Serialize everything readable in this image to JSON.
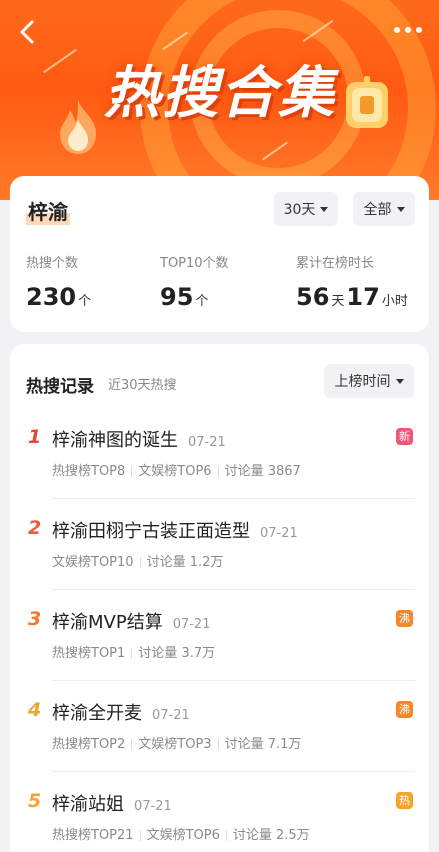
{
  "banner": {
    "title": "热搜合集"
  },
  "summary": {
    "name": "梓渝",
    "range_filter": "30天",
    "category_filter": "全部",
    "stats": [
      {
        "label": "热搜个数",
        "value": "230",
        "unit": "个"
      },
      {
        "label": "TOP10个数",
        "value": "95",
        "unit": "个"
      },
      {
        "label": "累计在榜时长",
        "days": "56",
        "days_unit": "天",
        "hours": "17",
        "hours_unit": "小时"
      }
    ]
  },
  "records": {
    "title": "热搜记录",
    "subtitle": "近30天热搜",
    "sort_label": "上榜时间",
    "items": [
      {
        "rank": "1",
        "title": "梓渝神图的诞生",
        "date": "07-21",
        "meta": [
          "热搜榜TOP8",
          "文娱榜TOP6",
          "讨论量 3867"
        ],
        "badge": "新",
        "badge_color": "#f0557a",
        "rank_color": "#e8443a"
      },
      {
        "rank": "2",
        "title": "梓渝田栩宁古装正面造型",
        "date": "07-21",
        "meta": [
          "文娱榜TOP10",
          "讨论量 1.2万"
        ],
        "badge": "",
        "badge_color": "",
        "rank_color": "#ee5a3d"
      },
      {
        "rank": "3",
        "title": "梓渝MVP结算",
        "date": "07-21",
        "meta": [
          "热搜榜TOP1",
          "讨论量 3.7万"
        ],
        "badge": "沸",
        "badge_color": "#f7862a",
        "rank_color": "#f27a2a"
      },
      {
        "rank": "4",
        "title": "梓渝全开麦",
        "date": "07-21",
        "meta": [
          "热搜榜TOP2",
          "文娱榜TOP3",
          "讨论量 7.1万"
        ],
        "badge": "沸",
        "badge_color": "#f7862a",
        "rank_color": "#f6a133"
      },
      {
        "rank": "5",
        "title": "梓渝站姐",
        "date": "07-21",
        "meta": [
          "热搜榜TOP21",
          "文娱榜TOP6",
          "讨论量 2.5万"
        ],
        "badge": "热",
        "badge_color": "#f6a32c",
        "rank_color": "#f6a133"
      }
    ]
  },
  "colors": {
    "accent": "#ff5a12",
    "badge_new": "#f0557a",
    "badge_boil": "#f7862a",
    "badge_hot": "#f6a32c"
  },
  "icons": [
    "back-icon",
    "more-icon",
    "fire-icon",
    "medal-icon"
  ]
}
